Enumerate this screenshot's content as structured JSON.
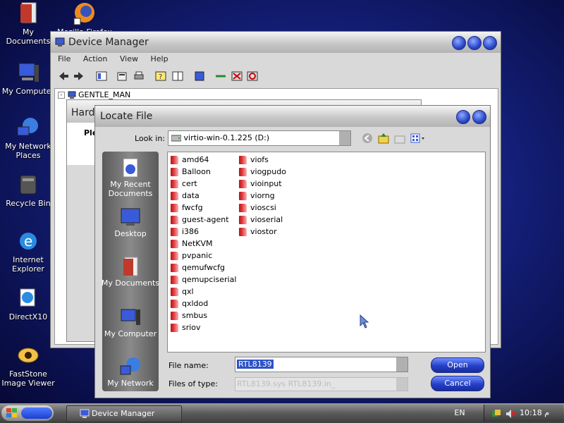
{
  "desktop": {
    "icons": [
      {
        "label": "My Documents"
      },
      {
        "label": "Mozilla Firefox"
      },
      {
        "label": "My Computer"
      },
      {
        "label": "My Network Places"
      },
      {
        "label": "Recycle Bin"
      },
      {
        "label": "Internet Explorer"
      },
      {
        "label": "DirectX10"
      },
      {
        "label": "FastStone Image Viewer"
      }
    ]
  },
  "device_manager": {
    "title": "Device Manager",
    "menu": [
      "File",
      "Action",
      "View",
      "Help"
    ],
    "tree_root": "GENTLE_MAN"
  },
  "hardware_wizard": {
    "title_fragment": "Hard",
    "text_fragment": "Ple"
  },
  "locate_file": {
    "title": "Locate File",
    "look_in_label": "Look in:",
    "look_in_value": "virtio-win-0.1.225 (D:)",
    "places": [
      "My Recent Documents",
      "Desktop",
      "My Documents",
      "My Computer",
      "My Network"
    ],
    "files_col1": [
      "amd64",
      "Balloon",
      "cert",
      "data",
      "fwcfg",
      "guest-agent",
      "i386",
      "NetKVM",
      "pvpanic",
      "qemufwcfg",
      "qemupciserial",
      "qxl",
      "qxldod",
      "smbus",
      "sriov"
    ],
    "files_col2": [
      "viofs",
      "viogpudo",
      "vioinput",
      "viorng",
      "vioscsi",
      "vioserial",
      "viostor"
    ],
    "file_name_label": "File name:",
    "file_name_value": "RTL8139",
    "file_type_label": "Files of type:",
    "file_type_value": "RTL8139.sys RTL8139.in_",
    "open_label": "Open",
    "cancel_label": "Cancel"
  },
  "taskbar": {
    "task_label": "Device Manager",
    "language": "EN",
    "clock": "10:18 م"
  },
  "colors": {
    "desktop": "#14207a",
    "accent_button": "#2540c8",
    "window_chrome": "#d9d9d9"
  }
}
